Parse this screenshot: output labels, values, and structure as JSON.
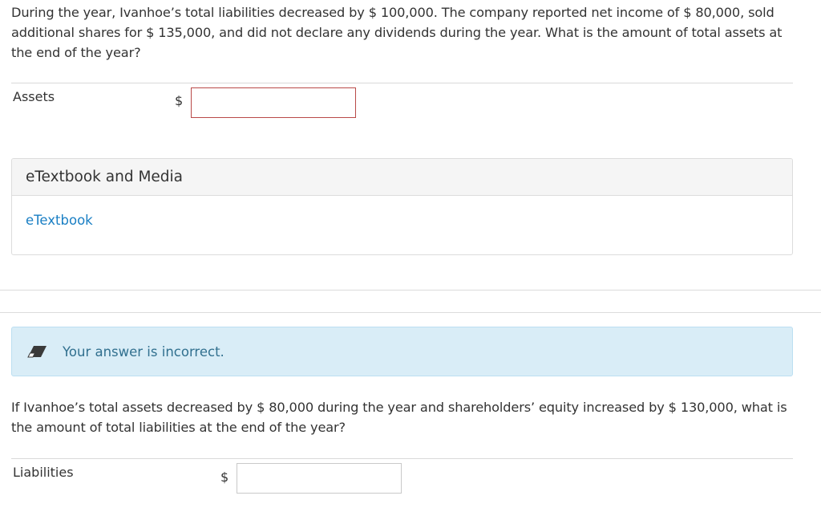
{
  "question1": {
    "text": "During the year, Ivanhoe’s total liabilities decreased by $ 100,000. The company reported net income of $ 80,000, sold additional shares for $ 135,000, and did not declare any dividends during the year. What is the amount of total assets at the end of the year?",
    "row_label": "Assets",
    "currency": "$",
    "input_value": ""
  },
  "media": {
    "header": "eTextbook and Media",
    "link": "eTextbook"
  },
  "feedback": {
    "icon": "eraser-icon",
    "message": "Your answer is incorrect."
  },
  "question2": {
    "text": "If Ivanhoe’s total assets decreased by $ 80,000 during the year and shareholders’ equity increased by $ 130,000, what is the amount of total liabilities at the end of the year?",
    "row_label": "Liabilities",
    "currency": "$",
    "input_value": ""
  },
  "colors": {
    "link": "#1a7fc4",
    "alert_bg": "#d9edf7",
    "alert_text": "#31708f",
    "invalid_border": "#b94a48"
  }
}
